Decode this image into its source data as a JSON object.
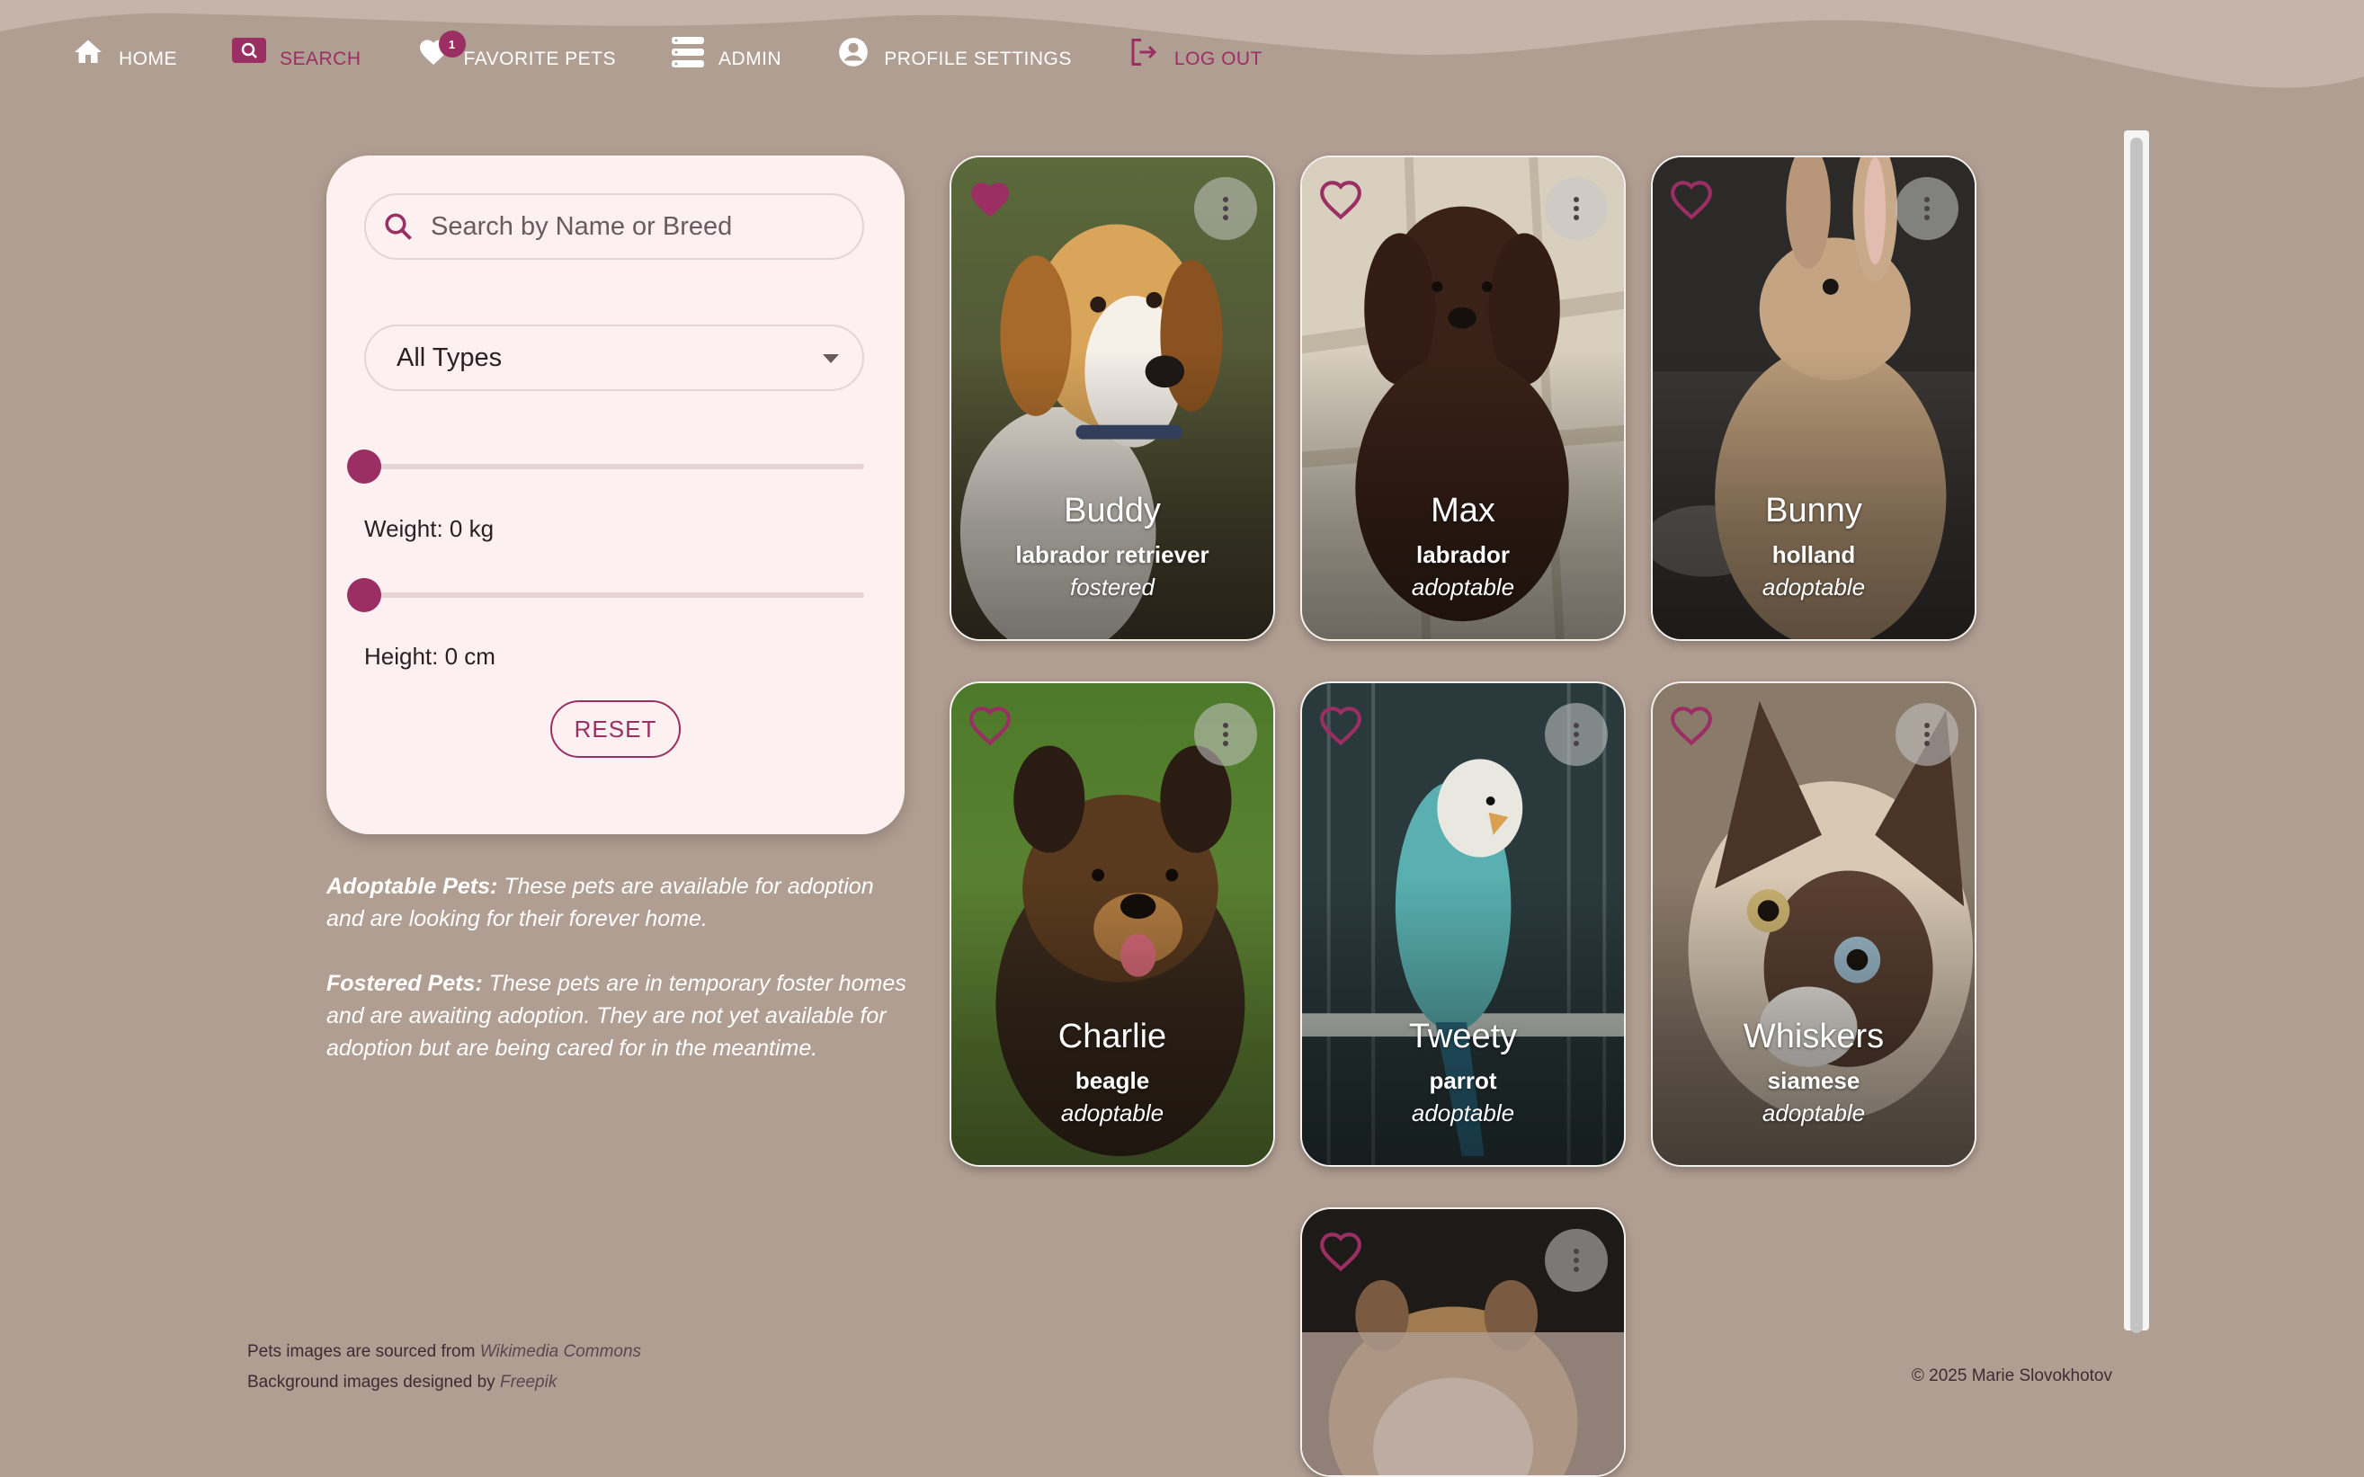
{
  "nav": {
    "items": [
      {
        "label": "HOME",
        "icon": "home-icon"
      },
      {
        "label": "SEARCH",
        "icon": "search-icon"
      },
      {
        "label": "FAVORITE PETS",
        "icon": "heart-icon",
        "badge": "1"
      },
      {
        "label": "ADMIN",
        "icon": "list-icon"
      },
      {
        "label": "PROFILE SETTINGS",
        "icon": "account-circle-icon"
      },
      {
        "label": "LOG OUT",
        "icon": "logout-icon"
      }
    ],
    "active": "SEARCH"
  },
  "filters": {
    "search_placeholder": "Search by Name or Breed",
    "search_value": "",
    "type_value": "All Types",
    "weight_label": "Weight: 0 kg",
    "weight_value": 0,
    "height_label": "Height: 0 cm",
    "height_value": 0,
    "reset_label": "RESET"
  },
  "info": {
    "adoptable_title": "Adoptable Pets:",
    "adoptable_text": " These pets are available for adoption and are looking for their forever home.",
    "fostered_title": "Fostered Pets:",
    "fostered_text": " These pets are in temporary foster homes and are awaiting adoption. They are not yet available for adoption but are being cared for in the meantime."
  },
  "pets": [
    {
      "name": "Buddy",
      "breed": "labrador retriever",
      "status": "fostered",
      "favorite": true
    },
    {
      "name": "Max",
      "breed": "labrador",
      "status": "adoptable",
      "favorite": false
    },
    {
      "name": "Bunny",
      "breed": "holland",
      "status": "adoptable",
      "favorite": false
    },
    {
      "name": "Charlie",
      "breed": "beagle",
      "status": "adoptable",
      "favorite": false
    },
    {
      "name": "Tweety",
      "breed": "parrot",
      "status": "adoptable",
      "favorite": false
    },
    {
      "name": "Whiskers",
      "breed": "siamese",
      "status": "adoptable",
      "favorite": false
    },
    {
      "name": "",
      "breed": "",
      "status": "",
      "favorite": false
    }
  ],
  "footer": {
    "images_text": "Pets images are sourced from ",
    "images_source": "Wikimedia Commons",
    "bg_text": "Background images designed by ",
    "bg_source": "Freepik",
    "copyright": "© 2025 Marie Slovokhotov"
  },
  "colors": {
    "accent": "#9b2e63",
    "background": "#b19e92",
    "panel": "#fcf0f0"
  }
}
